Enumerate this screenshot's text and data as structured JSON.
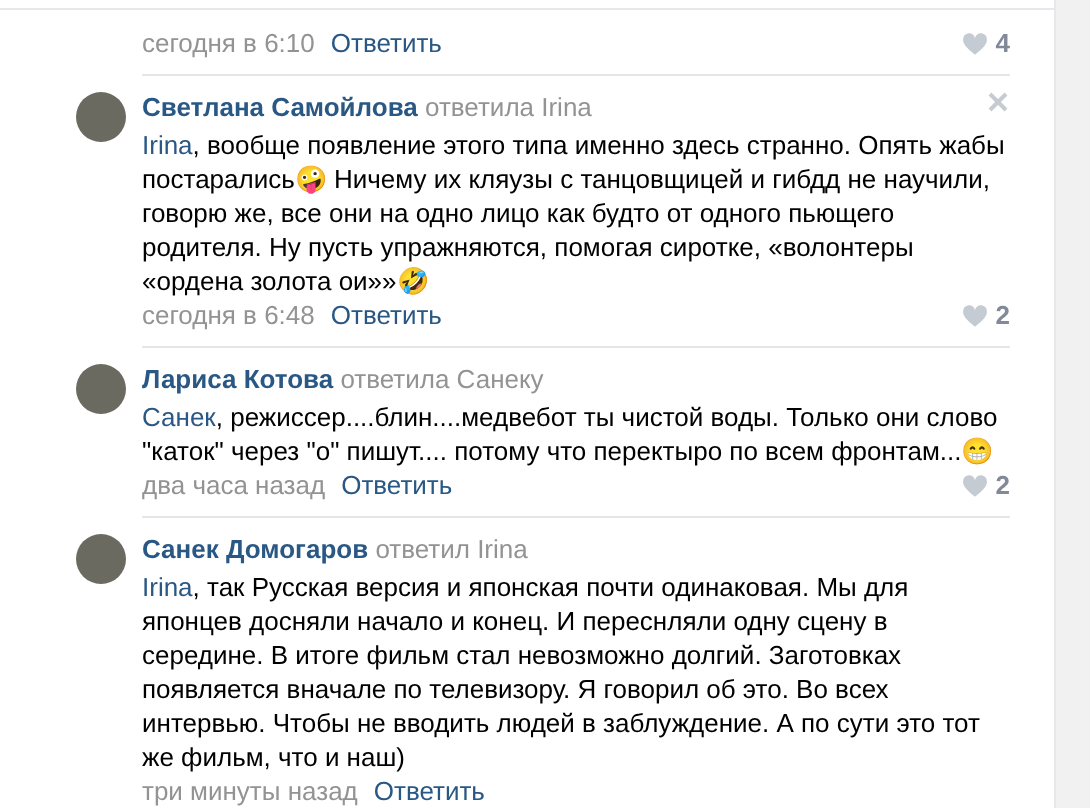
{
  "comments": [
    {
      "date": "сегодня в 6:10",
      "reply_action": "Ответить",
      "likes": "4"
    },
    {
      "author": "Светлана Самойлова",
      "reply_note": "ответила Irina",
      "deletable": true,
      "mention": "Irina",
      "text": ", вообще появление этого типа именно здесь странно. Опять жабы постарались🤪 Ничему их кляузы с танцовщицей и гибдд не научили, говорю же, все они на одно лицо как будто от одного пьющего родителя. Ну пусть упражняются, помогая сиротке, «волонтеры «ордена золота ои»»🤣",
      "date": "сегодня в 6:48",
      "reply_action": "Ответить",
      "likes": "2"
    },
    {
      "author": "Лариса Котова",
      "reply_note": "ответила Санеку",
      "deletable": false,
      "mention": "Санек",
      "text": ", режиссер....блин....медвебот ты чистой воды. Только они слово \"каток\" через \"о\" пишут.... потому что перектыро по всем фронтам...😁",
      "date": "два часа назад",
      "reply_action": "Ответить",
      "likes": "2"
    },
    {
      "author": "Санек Домогаров",
      "reply_note": "ответил Irina",
      "deletable": false,
      "mention": "Irina",
      "text": ", так Русская версия и японская почти одинаковая. Мы для японцев досняли начало и конец. И переснляли одну сцену в середине. В итоге фильм стал невозможно долгий. Заготовках появляется вначале по телевизору. Я говорил об это. Во всех интервью. Чтобы не вводить людей в заблуждение. А по сути это тот же фильм, что и наш)",
      "date": "три минуты назад",
      "reply_action": "Ответить"
    }
  ]
}
